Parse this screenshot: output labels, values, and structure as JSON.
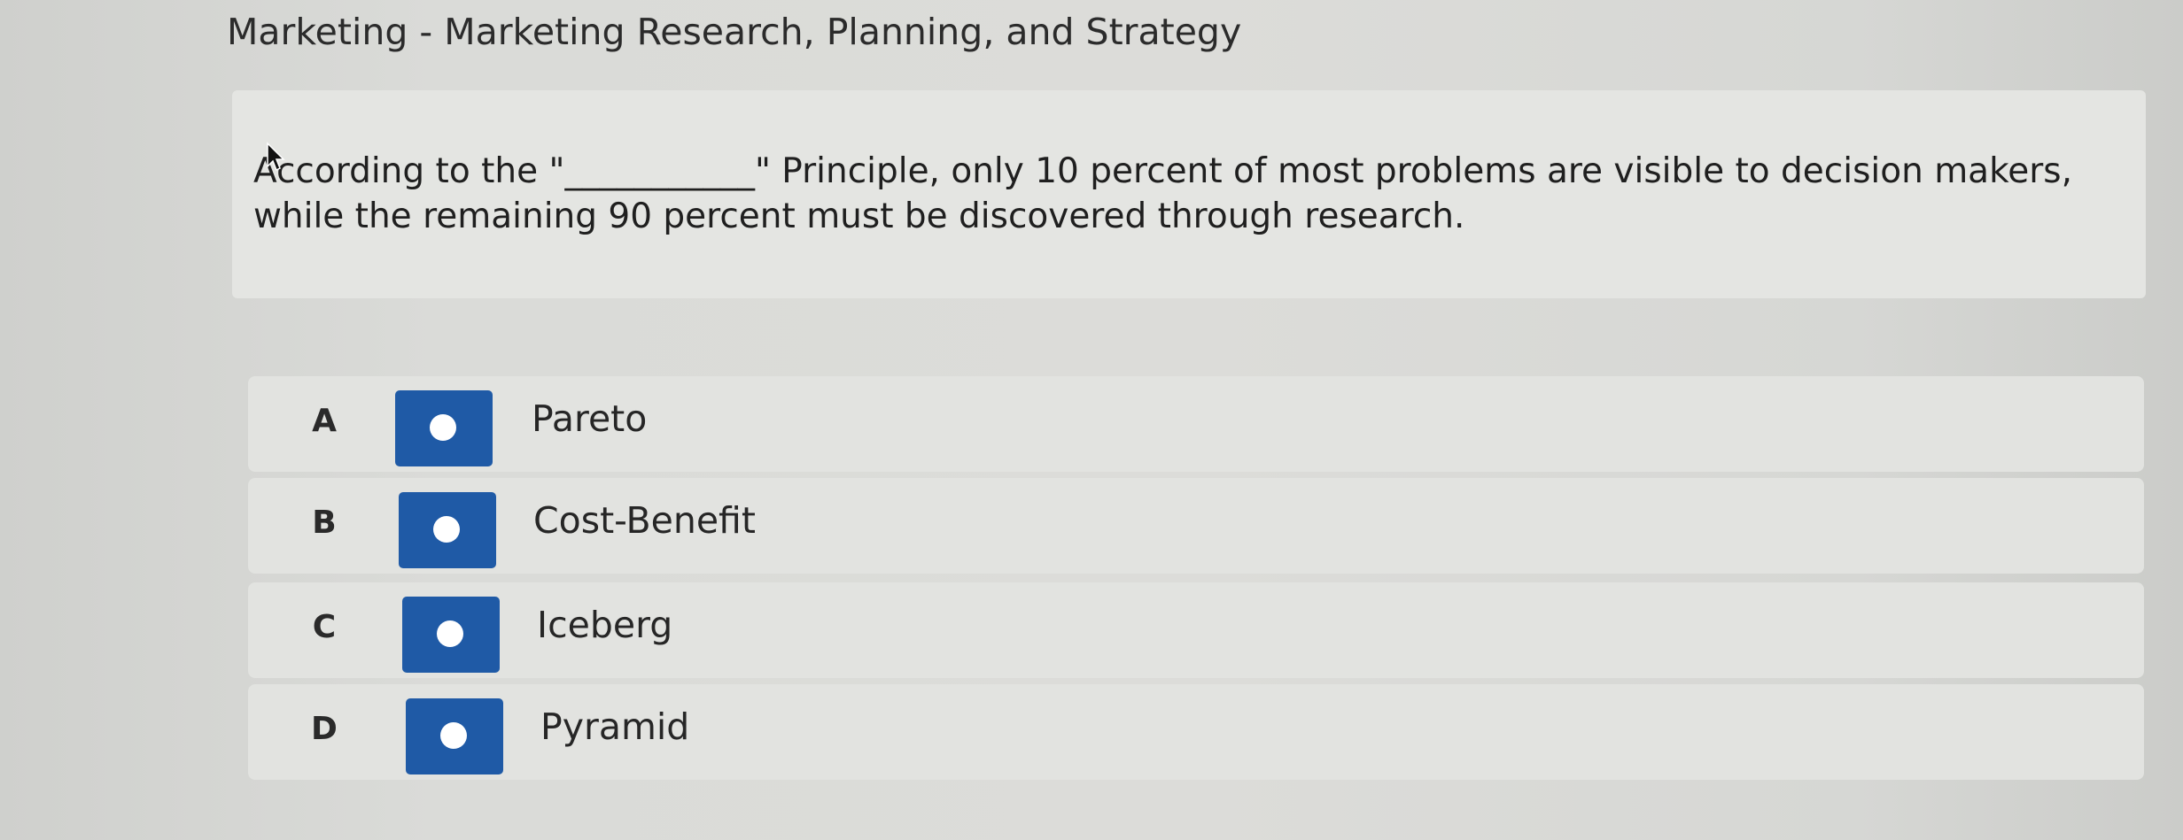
{
  "header": {
    "title": "Marketing - Marketing Research, Planning, and Strategy"
  },
  "question": {
    "text": "According to the \"___________\" Principle, only 10 percent of most problems are visible to decision makers, while the remaining 90 percent must be discovered through research."
  },
  "options": [
    {
      "letter": "A",
      "label": "Pareto"
    },
    {
      "letter": "B",
      "label": "Cost-Benefit"
    },
    {
      "letter": "C",
      "label": "Iceberg"
    },
    {
      "letter": "D",
      "label": "Pyramid"
    }
  ],
  "colors": {
    "radio_button": "#1f5aa6",
    "card_background": "#e4e5e2"
  },
  "icons": {
    "cursor": "mouse-pointer-icon",
    "radio": "radio-circle-icon"
  }
}
